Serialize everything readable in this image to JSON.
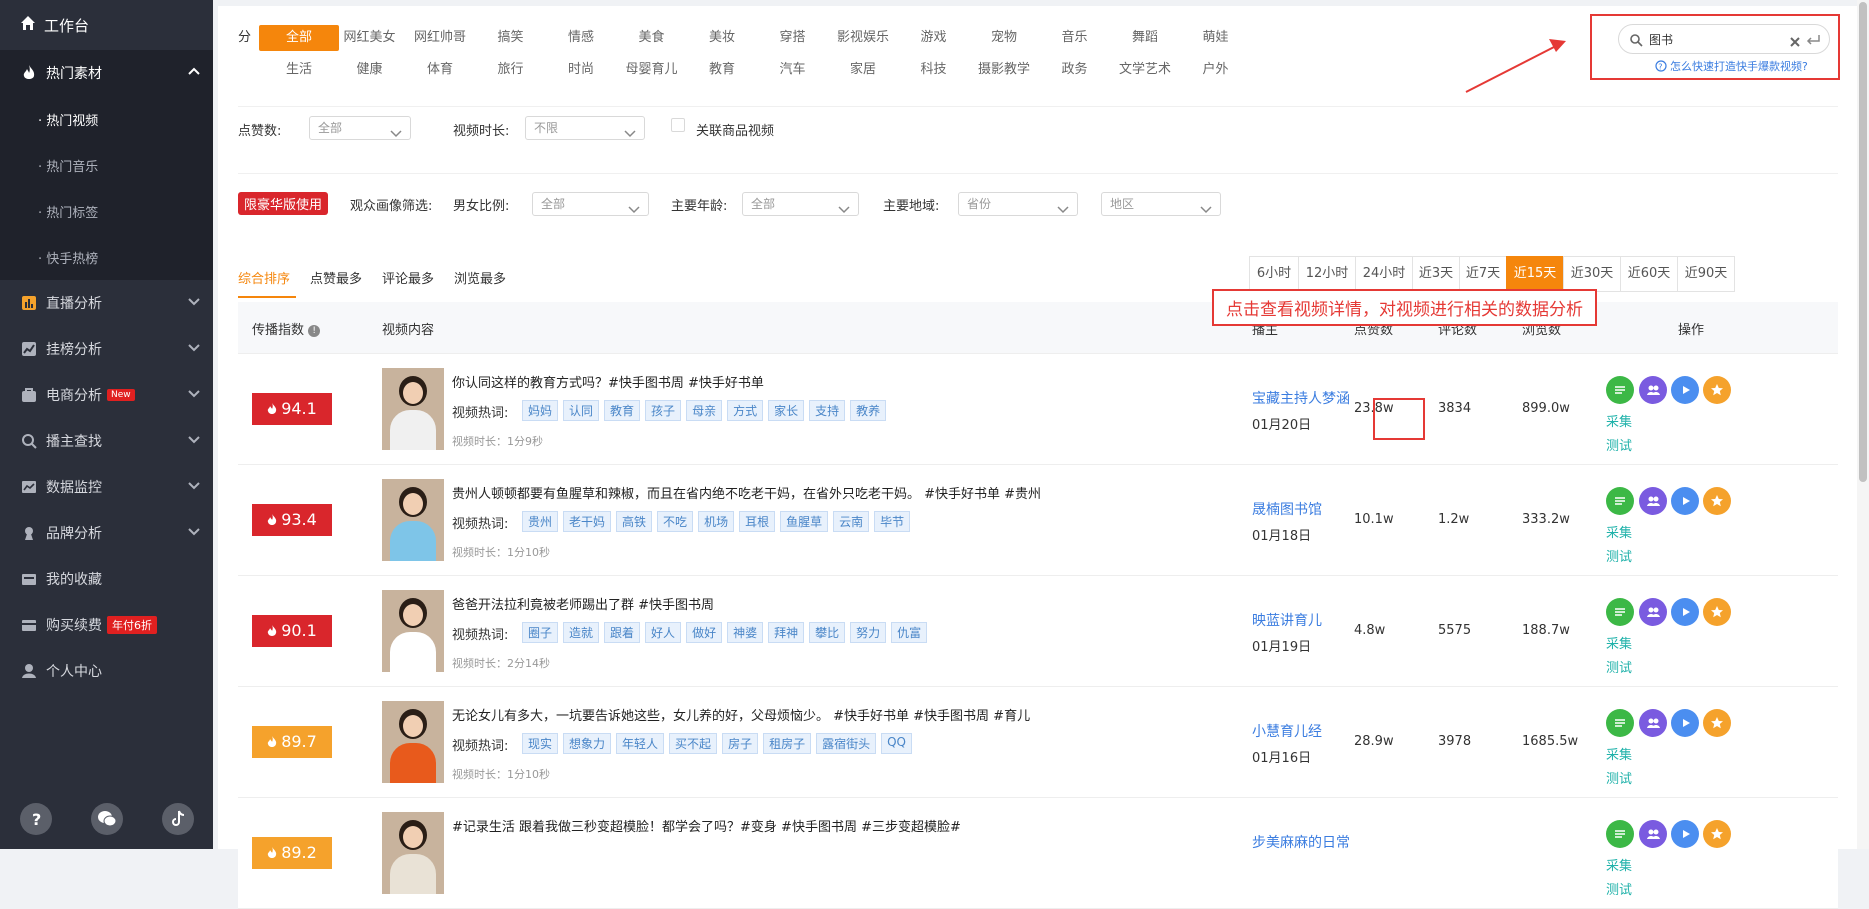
{
  "sidebar": {
    "top": {
      "label": "工作台",
      "icon": "home-icon"
    },
    "groups": [
      {
        "label": "热门素材",
        "icon": "flame-icon",
        "open": true,
        "subs": [
          "· 热门视频",
          "· 热门音乐",
          "· 热门标签",
          "· 快手热榜"
        ]
      },
      {
        "label": "直播分析",
        "icon": "bar-chart-icon"
      },
      {
        "label": "挂榜分析",
        "icon": "line-chart-icon"
      },
      {
        "label": "电商分析",
        "icon": "shop-icon",
        "badge": "New"
      },
      {
        "label": "播主查找",
        "icon": "search-icon"
      },
      {
        "label": "数据监控",
        "icon": "monitor-icon"
      },
      {
        "label": "品牌分析",
        "icon": "brand-icon"
      },
      {
        "label": "我的收藏",
        "icon": "collection-icon"
      },
      {
        "label": "购买续费",
        "icon": "purchase-icon",
        "badge": "年付6折"
      },
      {
        "label": "个人中心",
        "icon": "user-icon"
      }
    ],
    "bottom_icons": [
      "help-icon",
      "wechat-icon",
      "douyin-icon"
    ]
  },
  "filters": {
    "category_label": "分 类:",
    "categories_row1": [
      "全部",
      "网红美女",
      "网红帅哥",
      "搞笑",
      "情感",
      "美食",
      "美妆",
      "穿搭",
      "影视娱乐",
      "游戏",
      "宠物",
      "音乐",
      "舞蹈",
      "萌娃"
    ],
    "categories_row2": [
      "生活",
      "健康",
      "体育",
      "旅行",
      "时尚",
      "母婴育儿",
      "教育",
      "汽车",
      "家居",
      "科技",
      "摄影教学",
      "政务",
      "文学艺术",
      "户外"
    ],
    "active_category": "全部",
    "likes_label": "点赞数:",
    "likes_value": "全部",
    "duration_label": "视频时长:",
    "duration_value": "不限",
    "product_check_label": "关联商品视频",
    "vip_badge": "限豪华版使用",
    "audience_label": "观众画像筛选:",
    "gender_label": "男女比例:",
    "gender_value": "全部",
    "age_label": "主要年龄:",
    "age_value": "全部",
    "region_label": "主要地域:",
    "province_value": "省份",
    "area_value": "地区"
  },
  "search": {
    "value": "图书",
    "hint": "怎么快速打造快手爆款视频?"
  },
  "sort_tabs": [
    "综合排序",
    "点赞最多",
    "评论最多",
    "浏览最多"
  ],
  "active_sort": "综合排序",
  "time_filters": [
    "6小时",
    "12小时",
    "24小时",
    "近3天",
    "近7天",
    "近15天",
    "近30天",
    "近60天",
    "近90天"
  ],
  "active_time": "近15天",
  "annotation": "点击查看视频详情，对视频进行相关的数据分析",
  "table": {
    "headers": {
      "index": "传播指数",
      "content": "视频内容",
      "author": "播主",
      "likes": "点赞数",
      "comments": "评论数",
      "views": "浏览数",
      "ops": "操作"
    },
    "kw_label": "视频热词:",
    "op_collect": "采集",
    "op_test": "测试",
    "rows": [
      {
        "score": "94.1",
        "score_color": "#d9262c",
        "title": "你认同这样的教育方式吗？#快手图书周 #快手好书单",
        "keywords": [
          "妈妈",
          "认同",
          "教育",
          "孩子",
          "母亲",
          "方式",
          "家长",
          "支持",
          "教养"
        ],
        "duration": "视频时长：1分9秒",
        "author": "宝藏主持人梦涵",
        "date": "01月20日",
        "likes": "23.8w",
        "comments": "3834",
        "views": "899.0w"
      },
      {
        "score": "93.4",
        "score_color": "#d9262c",
        "title": "贵州人顿顿都要有鱼腥草和辣椒，而且在省内绝不吃老干妈，在省外只吃老干妈。 #快手好书单 #贵州",
        "keywords": [
          "贵州",
          "老干妈",
          "高铁",
          "不吃",
          "机场",
          "耳根",
          "鱼腥草",
          "云南",
          "毕节"
        ],
        "duration": "视频时长：1分10秒",
        "author": "晟楠图书馆",
        "date": "01月18日",
        "likes": "10.1w",
        "comments": "1.2w",
        "views": "333.2w"
      },
      {
        "score": "90.1",
        "score_color": "#d9262c",
        "title": "爸爸开法拉利竟被老师踢出了群 #快手图书周",
        "keywords": [
          "圈子",
          "造就",
          "跟着",
          "好人",
          "做好",
          "神婆",
          "拜神",
          "攀比",
          "努力",
          "仇富"
        ],
        "duration": "视频时长：2分14秒",
        "author": "映蓝讲育儿",
        "date": "01月19日",
        "likes": "4.8w",
        "comments": "5575",
        "views": "188.7w"
      },
      {
        "score": "89.7",
        "score_color": "#f5a22c",
        "title": "无论女儿有多大，一坑要告诉她这些，女儿养的好，父母烦恼少。 #快手好书单 #快手图书周 #育儿",
        "keywords": [
          "现实",
          "想象力",
          "年轻人",
          "买不起",
          "房子",
          "租房子",
          "露宿街头",
          "QQ"
        ],
        "duration": "视频时长：1分10秒",
        "author": "小慧育儿经",
        "date": "01月16日",
        "likes": "28.9w",
        "comments": "3978",
        "views": "1685.5w"
      },
      {
        "score": "89.2",
        "score_color": "#f5a22c",
        "title": "#记录生活 跟着我做三秒变超模脸！都学会了吗？#变身 #快手图书周 #三步变超模脸#",
        "keywords": [],
        "duration": "",
        "author": "步美麻麻的日常",
        "date": "",
        "likes": "",
        "comments": "",
        "views": ""
      }
    ]
  },
  "colors": {
    "accent": "#f5860c",
    "link": "#3b7de0",
    "green": "#3cb846",
    "purple": "#7a5be0",
    "blue": "#4b8ef0",
    "orange": "#f5a22c"
  }
}
